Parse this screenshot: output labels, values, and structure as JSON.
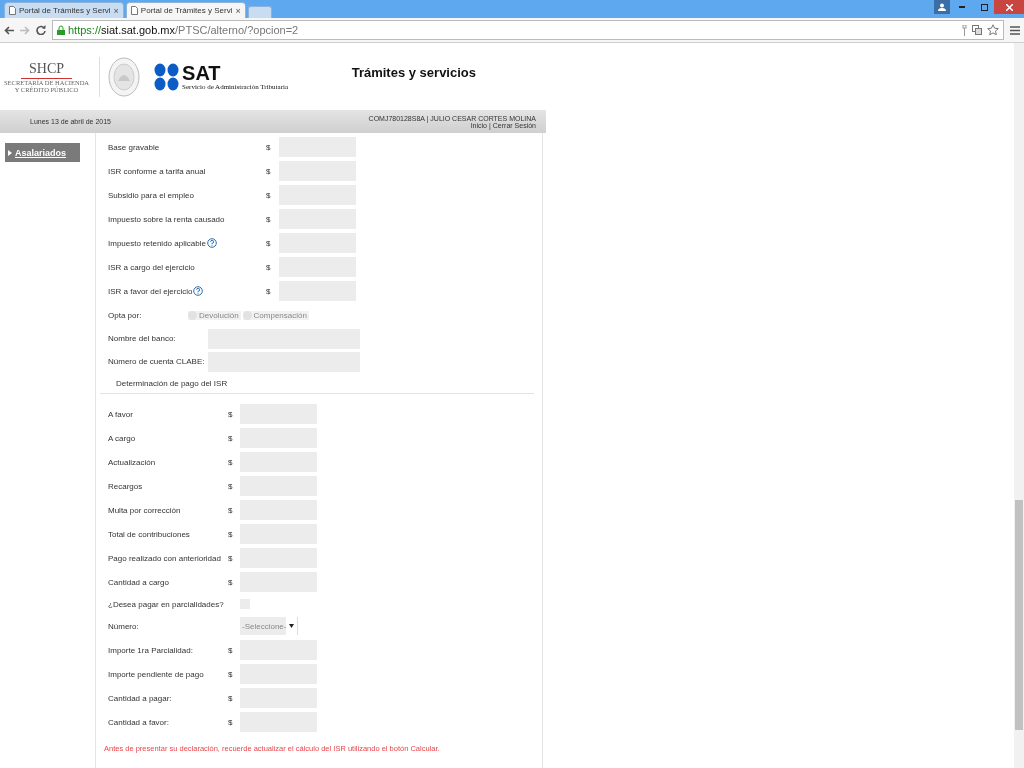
{
  "browser": {
    "tabs": [
      {
        "title": "Portal de Trámites y Servi",
        "selected": false
      },
      {
        "title": "Portal de Trámites y Servi",
        "selected": true
      }
    ],
    "close_glyph": "×",
    "url": {
      "scheme": "https://",
      "host": "siat.sat.gob.mx",
      "path": "/PTSC/alterno/?opcion=2"
    }
  },
  "header": {
    "shcp": "SHCP",
    "shcp_lines": [
      "SECRETARÍA DE HACIENDA",
      "Y CRÉDITO PÚBLICO"
    ],
    "sat": "SAT",
    "sat_sub": "Servicio de Administración Tributaria",
    "title": "Trámites y servicios"
  },
  "infobar": {
    "date": "Lunes 13 de abril de 2015",
    "user": "COMJ780128S8A | JULIO CESAR CORTES MOLINA",
    "links": [
      "Inicio",
      "Cerrar Sesión"
    ],
    "separator": "|"
  },
  "sidebar": {
    "items": [
      {
        "label": "Asalariados",
        "selected": true
      }
    ]
  },
  "calc_rows": [
    {
      "label": "Base gravable",
      "currency": "$",
      "help": false
    },
    {
      "label": "ISR conforme a tarifa anual",
      "currency": "$",
      "help": false
    },
    {
      "label": "Subsidio para el empleo",
      "currency": "$",
      "help": false
    },
    {
      "label": "Impuesto sobre la renta causado",
      "currency": "$",
      "help": false
    },
    {
      "label": "Impuesto retenido aplicable",
      "currency": "$",
      "help": true
    },
    {
      "label": "ISR a cargo del ejercicio",
      "currency": "$",
      "help": false
    },
    {
      "label": "ISR a favor del ejercicio",
      "currency": "$",
      "help": true
    }
  ],
  "opta": {
    "label": "Opta por:",
    "options": [
      {
        "label": "Devolución",
        "selected": false
      },
      {
        "label": "Compensación",
        "selected": false
      }
    ]
  },
  "bank_rows": [
    {
      "label": "Nombre del banco:"
    },
    {
      "label": "Número de cuenta CLABE:"
    }
  ],
  "section_title": "Determinación de pago del ISR",
  "pay_rows": [
    {
      "kind": "amount",
      "label": "A favor",
      "currency": "$"
    },
    {
      "kind": "amount",
      "label": "A cargo",
      "currency": "$"
    },
    {
      "kind": "amount",
      "label": "Actualización",
      "currency": "$"
    },
    {
      "kind": "amount",
      "label": "Recargos",
      "currency": "$"
    },
    {
      "kind": "amount",
      "label": "Multa por corrección",
      "currency": "$"
    },
    {
      "kind": "amount",
      "label": "Total de contribuciones",
      "currency": "$"
    },
    {
      "kind": "amount",
      "label": "Pago realizado con anterioridad",
      "currency": "$"
    },
    {
      "kind": "amount",
      "label": "Cantidad a cargo",
      "currency": "$"
    },
    {
      "kind": "checkbox",
      "label": "¿Desea pagar en parcialidades?",
      "checked": false
    },
    {
      "kind": "select",
      "label": "Número:",
      "placeholder": "-Seleccione-"
    },
    {
      "kind": "amount",
      "label": "Importe 1ra Parcialidad:",
      "currency": "$"
    },
    {
      "kind": "amount",
      "label": "Importe pendiente de pago",
      "currency": "$"
    },
    {
      "kind": "amount",
      "label": "Cantidad a pagar:",
      "currency": "$"
    },
    {
      "kind": "amount",
      "label": "Cantidad a favor:",
      "currency": "$"
    }
  ],
  "warning": "Antes de presentar su declaración, recuerde actualizar el cálculo del ISR utilizando el botón Calcular."
}
